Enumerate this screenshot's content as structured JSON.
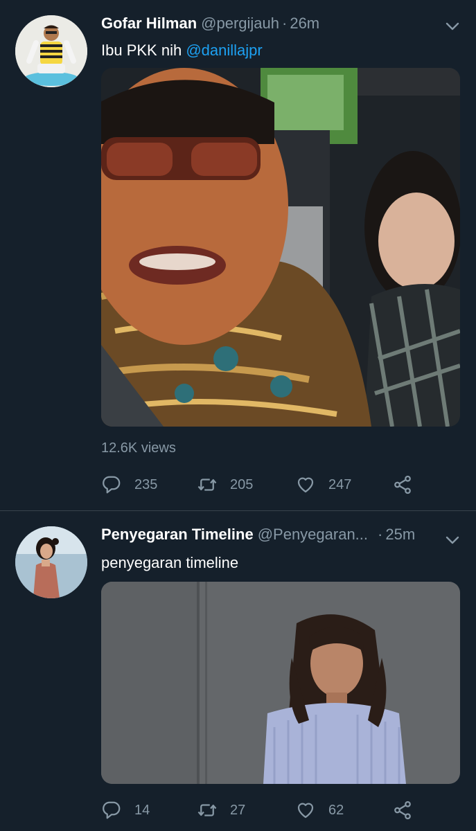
{
  "tweets": [
    {
      "name": "Gofar Hilman",
      "handle": "@pergijauh",
      "separator": "·",
      "time": "26m",
      "text": "Ibu PKK nih ",
      "mention": "@danillajpr",
      "views": "12.6K views",
      "replies": "235",
      "retweets": "205",
      "likes": "247"
    },
    {
      "name": "Penyegaran Timeline",
      "handle": "@Penyegaran...",
      "separator": "·",
      "time": "25m",
      "text": "penyegaran timeline",
      "replies": "14",
      "retweets": "27",
      "likes": "62"
    }
  ],
  "colors": {
    "background": "#15202b",
    "secondary_text": "#8899a6",
    "link": "#1da1f2",
    "divider": "#38444d"
  },
  "icons": [
    "chevron-down-icon",
    "reply-icon",
    "retweet-icon",
    "like-icon",
    "share-icon"
  ]
}
